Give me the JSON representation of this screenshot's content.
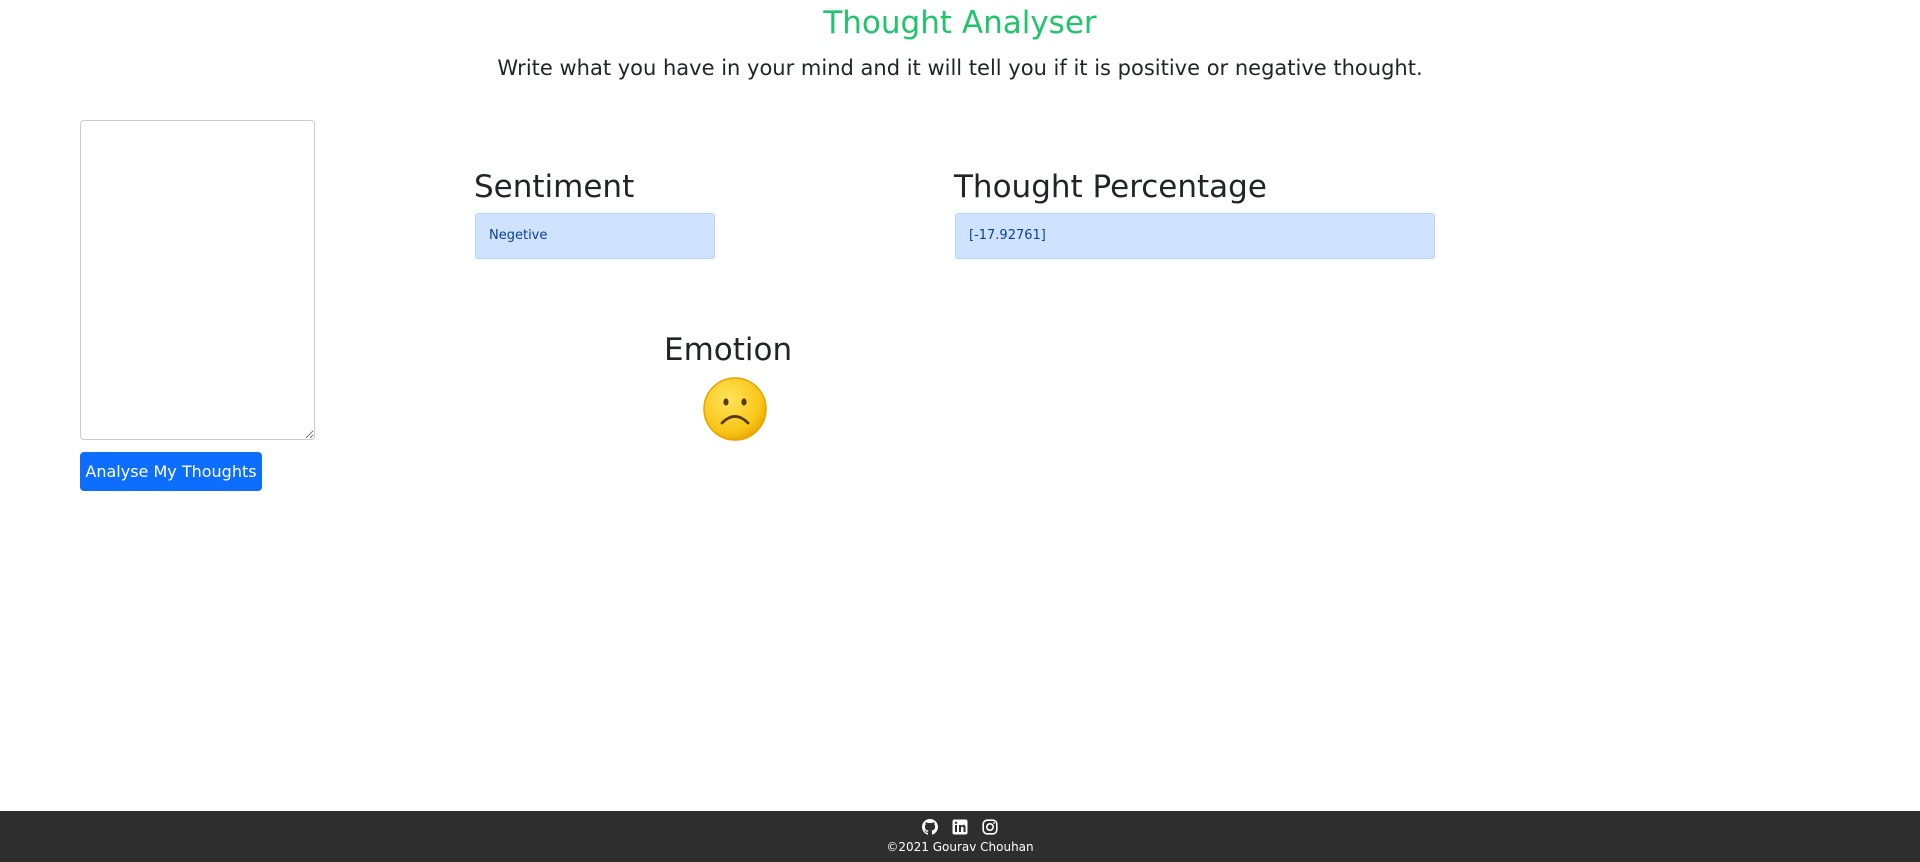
{
  "header": {
    "title": "Thought Analyser",
    "subtitle": "Write what you have in your mind and it will tell you if it is positive or negative thought."
  },
  "input": {
    "value": "",
    "placeholder": ""
  },
  "analyse_button": {
    "label": "Analyse My Thoughts"
  },
  "results": {
    "sentiment_heading": "Sentiment",
    "sentiment_value": "Negetive",
    "percentage_heading": "Thought Percentage",
    "percentage_value": "[-17.92761]",
    "emotion_heading": "Emotion",
    "emotion_icon": "frowning-face-icon"
  },
  "footer": {
    "icons": [
      "github-icon",
      "linkedin-icon",
      "instagram-icon"
    ],
    "copyright": "©2021 Gourav Chouhan"
  },
  "colors": {
    "title": "#1fc46c",
    "button": "#0d6efd",
    "alert_bg": "#cfe2ff",
    "alert_text": "#084298",
    "footer_bg": "#2e2e2e"
  }
}
